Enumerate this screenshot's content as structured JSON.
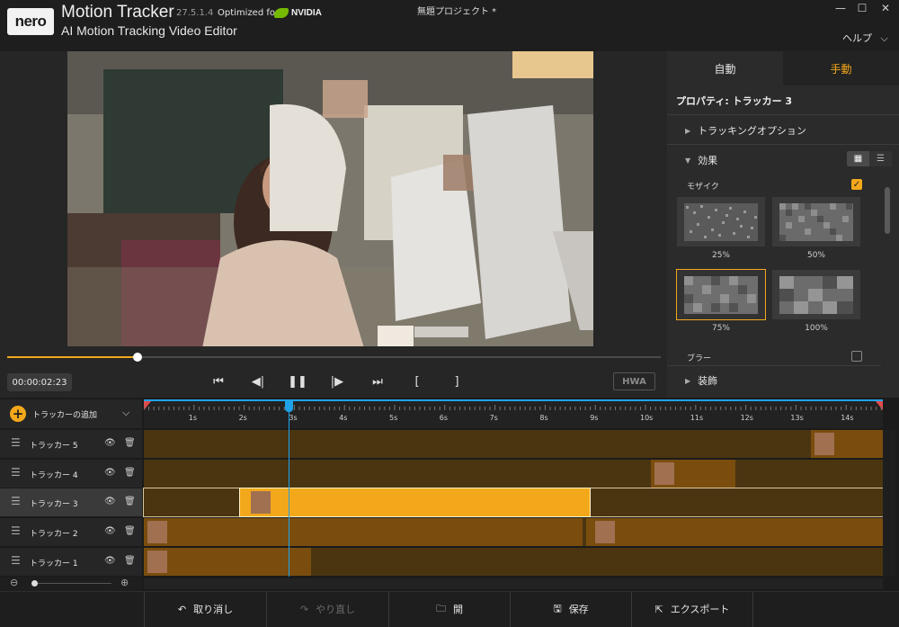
{
  "titlebar": {
    "logo": "nero",
    "app_name": "Motion Tracker",
    "version": "27.5.1.4",
    "optimized_for": "Optimized for",
    "nvidia": "NVIDIA",
    "subtitle": "AI Motion Tracking Video Editor",
    "document_title": "無題プロジェクト *",
    "window_buttons": [
      "minimize-icon",
      "maximize-icon",
      "close-icon"
    ],
    "help_menu": "ヘルプ"
  },
  "player": {
    "timecode": "00:00:02:23",
    "progress": 0.2,
    "hwa_label": "HWA",
    "transport_icons": [
      "skip-start-icon",
      "step-back-icon",
      "pause-icon",
      "step-forward-icon",
      "skip-end-icon",
      "mark-in-icon",
      "mark-out-icon"
    ]
  },
  "panel": {
    "tabs": [
      {
        "label": "自動",
        "active": false
      },
      {
        "label": "手動",
        "active": true
      }
    ],
    "properties_title": "プロパティ: トラッカー 3",
    "tracking_options": "トラッキングオプション",
    "effects": "効果",
    "mosaic_label": "モザイク",
    "mosaic_checked": true,
    "mosaic_options": [
      "25%",
      "50%",
      "75%",
      "100%"
    ],
    "mosaic_selected": "75%",
    "blur_label": "ブラー",
    "blur_checked": false,
    "decoration": "装飾"
  },
  "timeline": {
    "add_tracker": "トラッカーの追加",
    "ticks": [
      "1s",
      "2s",
      "3s",
      "4s",
      "5s",
      "6s",
      "7s",
      "8s",
      "9s",
      "10s",
      "11s",
      "12s",
      "13s",
      "14s"
    ],
    "tracks": [
      {
        "name": "トラッカー 5",
        "active": false
      },
      {
        "name": "トラッカー 4",
        "active": false
      },
      {
        "name": "トラッカー 3",
        "active": true
      },
      {
        "name": "トラッカー 2",
        "active": false
      },
      {
        "name": "トラッカー 1",
        "active": false
      }
    ]
  },
  "bottombar": {
    "undo": "取り消し",
    "redo": "やり直し",
    "open": "開",
    "save": "保存",
    "export": "エクスポート"
  },
  "colors": {
    "accent": "#f3a81b",
    "playhead": "#1fa3e8",
    "clip": "#7a4d0e",
    "lane": "#4a3510"
  }
}
